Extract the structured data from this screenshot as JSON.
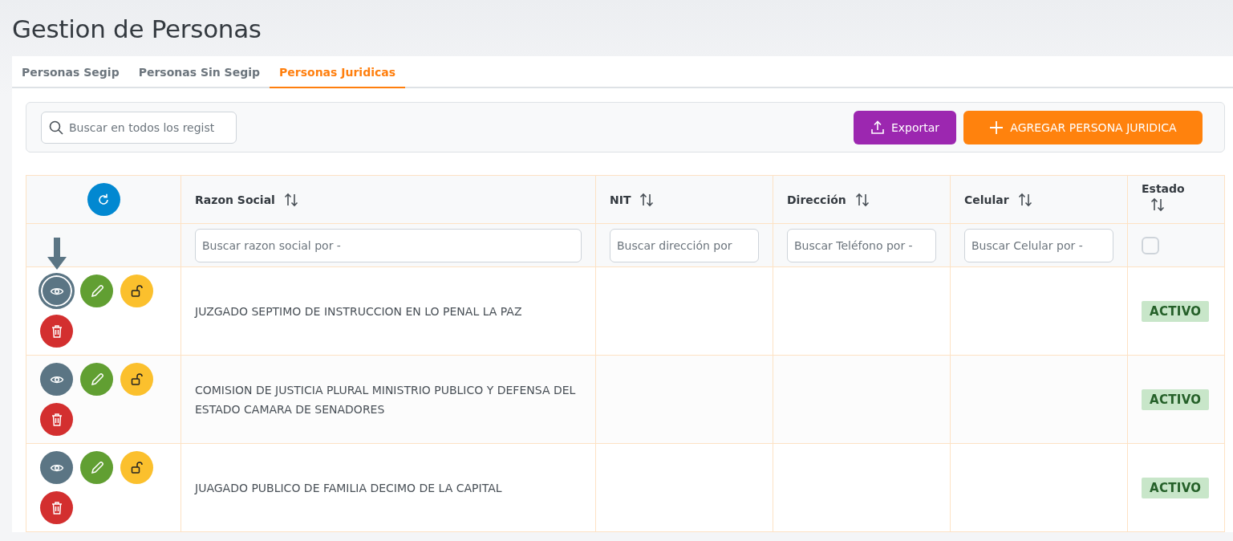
{
  "page_title": "Gestion de Personas",
  "tabs": [
    {
      "label": "Personas Segip",
      "selected": false
    },
    {
      "label": "Personas Sin Segip",
      "selected": false
    },
    {
      "label": "Personas Juridicas",
      "selected": true
    }
  ],
  "toolbar": {
    "search": {
      "placeholder": "Buscar en todos los regist"
    },
    "export_button": "Exportar",
    "add_button": "AGREGAR PERSONA JURIDICA"
  },
  "table": {
    "columns": [
      {
        "label": "Razon Social",
        "placeholder": "Buscar razon social por -"
      },
      {
        "label": "NIT",
        "placeholder": "Buscar dirección por"
      },
      {
        "label": "Dirección",
        "placeholder": "Buscar Teléfono por -"
      },
      {
        "label": "Celular",
        "placeholder": "Buscar Celular por -"
      },
      {
        "label": "Estado",
        "checked": false
      }
    ],
    "rows": [
      {
        "razon_social": "JUZGADO SEPTIMO DE INSTRUCCION EN LO PENAL LA PAZ",
        "estado": "ACTIVO",
        "focused": true
      },
      {
        "razon_social": "COMISION DE JUSTICIA PLURAL MINISTRIO PUBLICO Y DEFENSA DEL ESTADO CAMARA DE SENADORES",
        "estado": "ACTIVO",
        "focused": false
      },
      {
        "razon_social": "JUAGADO PUBLICO DE FAMILIA DECIMO DE LA CAPITAL",
        "estado": "ACTIVO",
        "focused": false
      }
    ]
  }
}
